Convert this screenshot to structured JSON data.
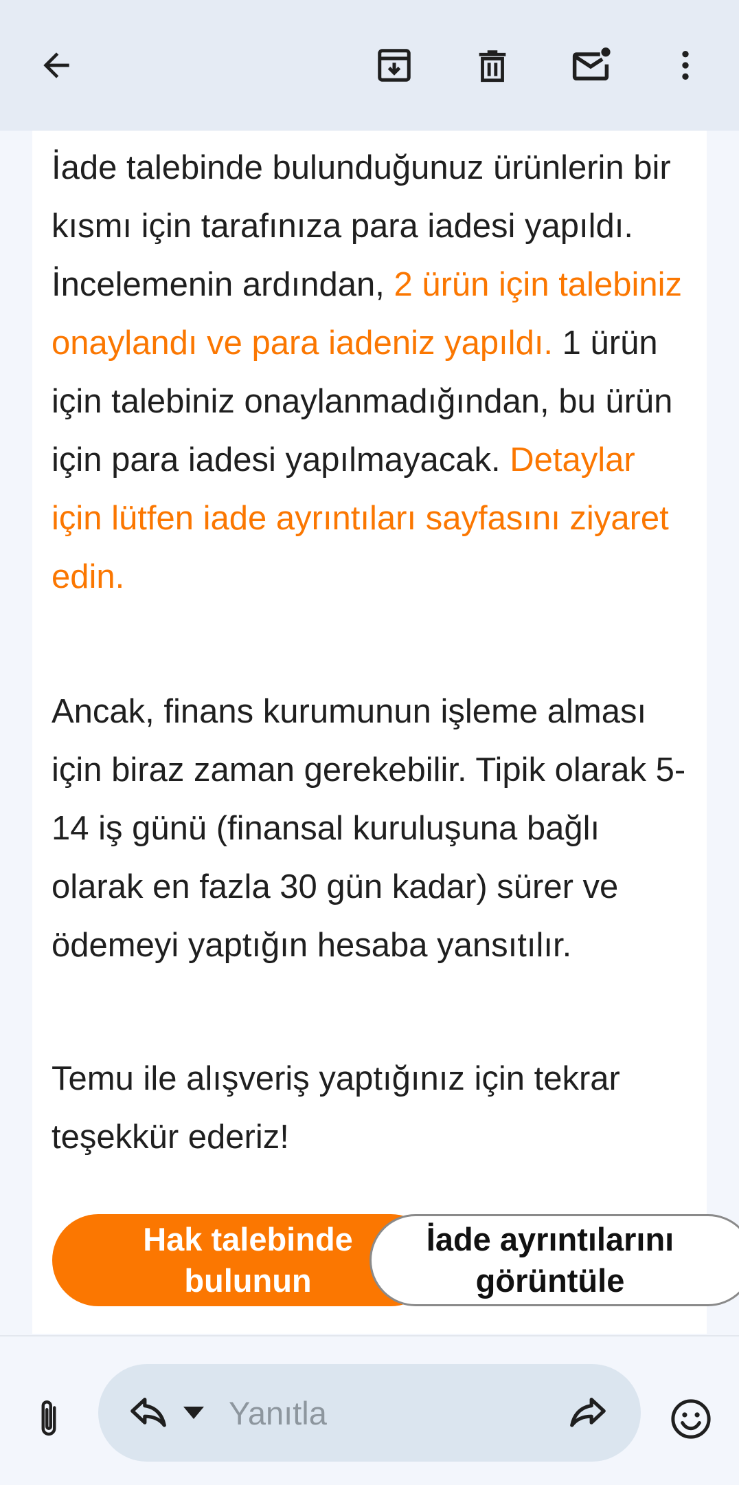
{
  "topbar": {
    "icons": [
      "back-icon",
      "archive-icon",
      "delete-icon",
      "mark-unread-icon",
      "more-vert-icon"
    ]
  },
  "email": {
    "paragraph1": {
      "part1": "İade talebinde bulunduğunuz ürünlerin bir kısmı için tarafınıza para iadesi yapıldı. İncelemenin ardından, ",
      "highlight1": "2 ürün için talebiniz onaylandı ve para iadeniz yapıldı.",
      "part2": " 1 ürün için talebiniz onaylanmadığından, bu ürün için para iadesi yapılmayacak. ",
      "highlight2": "Detaylar için lütfen iade ayrıntıları sayfasını ziyaret edin."
    },
    "paragraph2": "Ancak, finans kurumunun işleme alması için biraz zaman gerekebilir. Tipik olarak 5-14 iş günü (finansal kuruluşuna bağlı olarak en fazla 30 gün kadar) sürer ve ödemeyi yaptığın hesaba yansıtılır.",
    "paragraph3": "Temu ile alışveriş yaptığınız için tekrar teşekkür ederiz!"
  },
  "buttons": {
    "claim_label": "Hak talebinde bulunun",
    "details_label": "İade ayrıntılarını görüntüle"
  },
  "reply_bar": {
    "placeholder": "Yanıtla",
    "icons": [
      "attach-icon",
      "reply-icon",
      "dropdown-caret-icon",
      "forward-icon",
      "emoji-icon"
    ]
  },
  "colors": {
    "accent": "#fb7701",
    "topbar": "#e5ebf4",
    "reply_pill": "#dbe5ef"
  }
}
